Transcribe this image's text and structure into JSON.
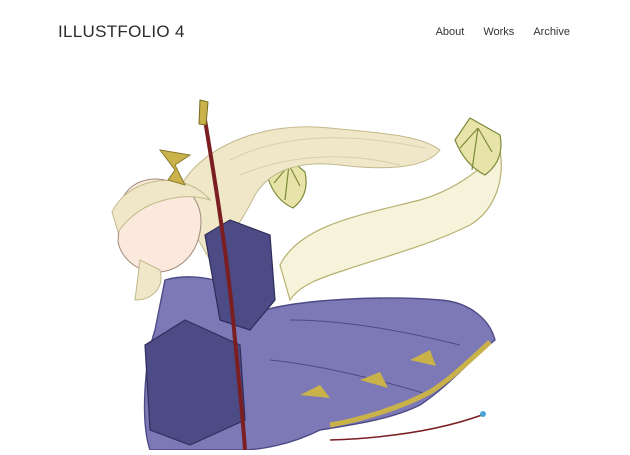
{
  "site": {
    "title": "ILLUSTFOLIO 4"
  },
  "nav": {
    "items": [
      "About",
      "Works",
      "Archive"
    ]
  },
  "hero": {
    "subject": "elf-archer-illustration"
  },
  "colors": {
    "text": "#2b2b2b",
    "hair": "#efe7c7",
    "dress": "#7d78b6",
    "dress_dark": "#4d4b86",
    "gold": "#c9b24a",
    "bow": "#7a1e22"
  }
}
